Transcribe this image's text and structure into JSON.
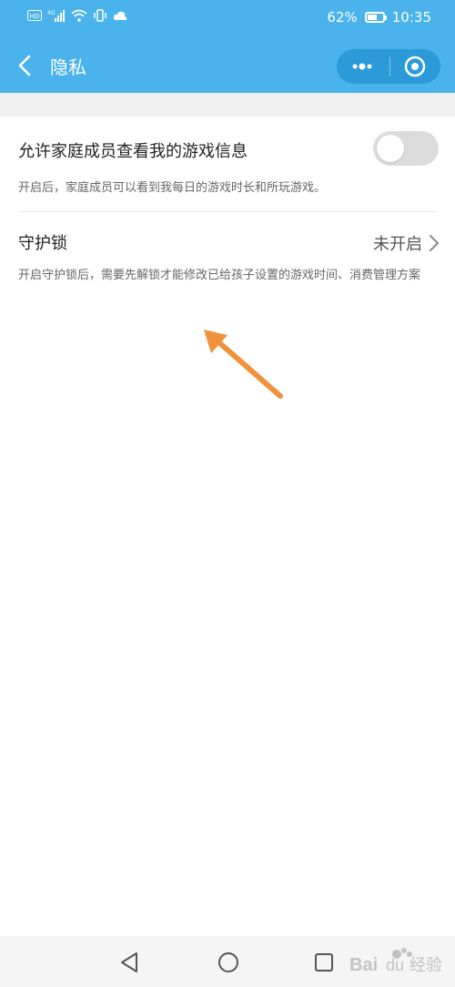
{
  "status_bar": {
    "icons": [
      "hd-icon",
      "signal-4g-icon",
      "wifi-icon",
      "vibrate-icon",
      "cloud-icon"
    ],
    "battery_level": 0.62,
    "battery_percent": "62%",
    "time": "10:35"
  },
  "nav": {
    "title": "隐私",
    "back_icon": "chevron-left-icon",
    "capsule_more_icon": "more-dots-icon",
    "capsule_close_icon": "target-circle-icon"
  },
  "privacy": {
    "family_view": {
      "title": "允许家庭成员查看我的游戏信息",
      "description": "开启后，家庭成员可以看到我每日的游戏时长和所玩游戏。",
      "enabled": false
    },
    "guard_lock": {
      "title": "守护锁",
      "status": "未开启",
      "description": "开启守护锁后，需要先解锁才能修改已给孩子设置的游戏时间、消费管理方案"
    }
  },
  "annotation": {
    "arrow_color": "#f0923c"
  },
  "system_nav": {
    "icons": [
      "back-triangle-icon",
      "home-circle-icon",
      "recent-square-icon"
    ]
  },
  "watermark": {
    "text": "Bai du 经验"
  },
  "colors": {
    "header_bg": "#4ab3ec",
    "capsule_bg": "#2c9ad9",
    "toggle_off": "#dcdcdc"
  }
}
